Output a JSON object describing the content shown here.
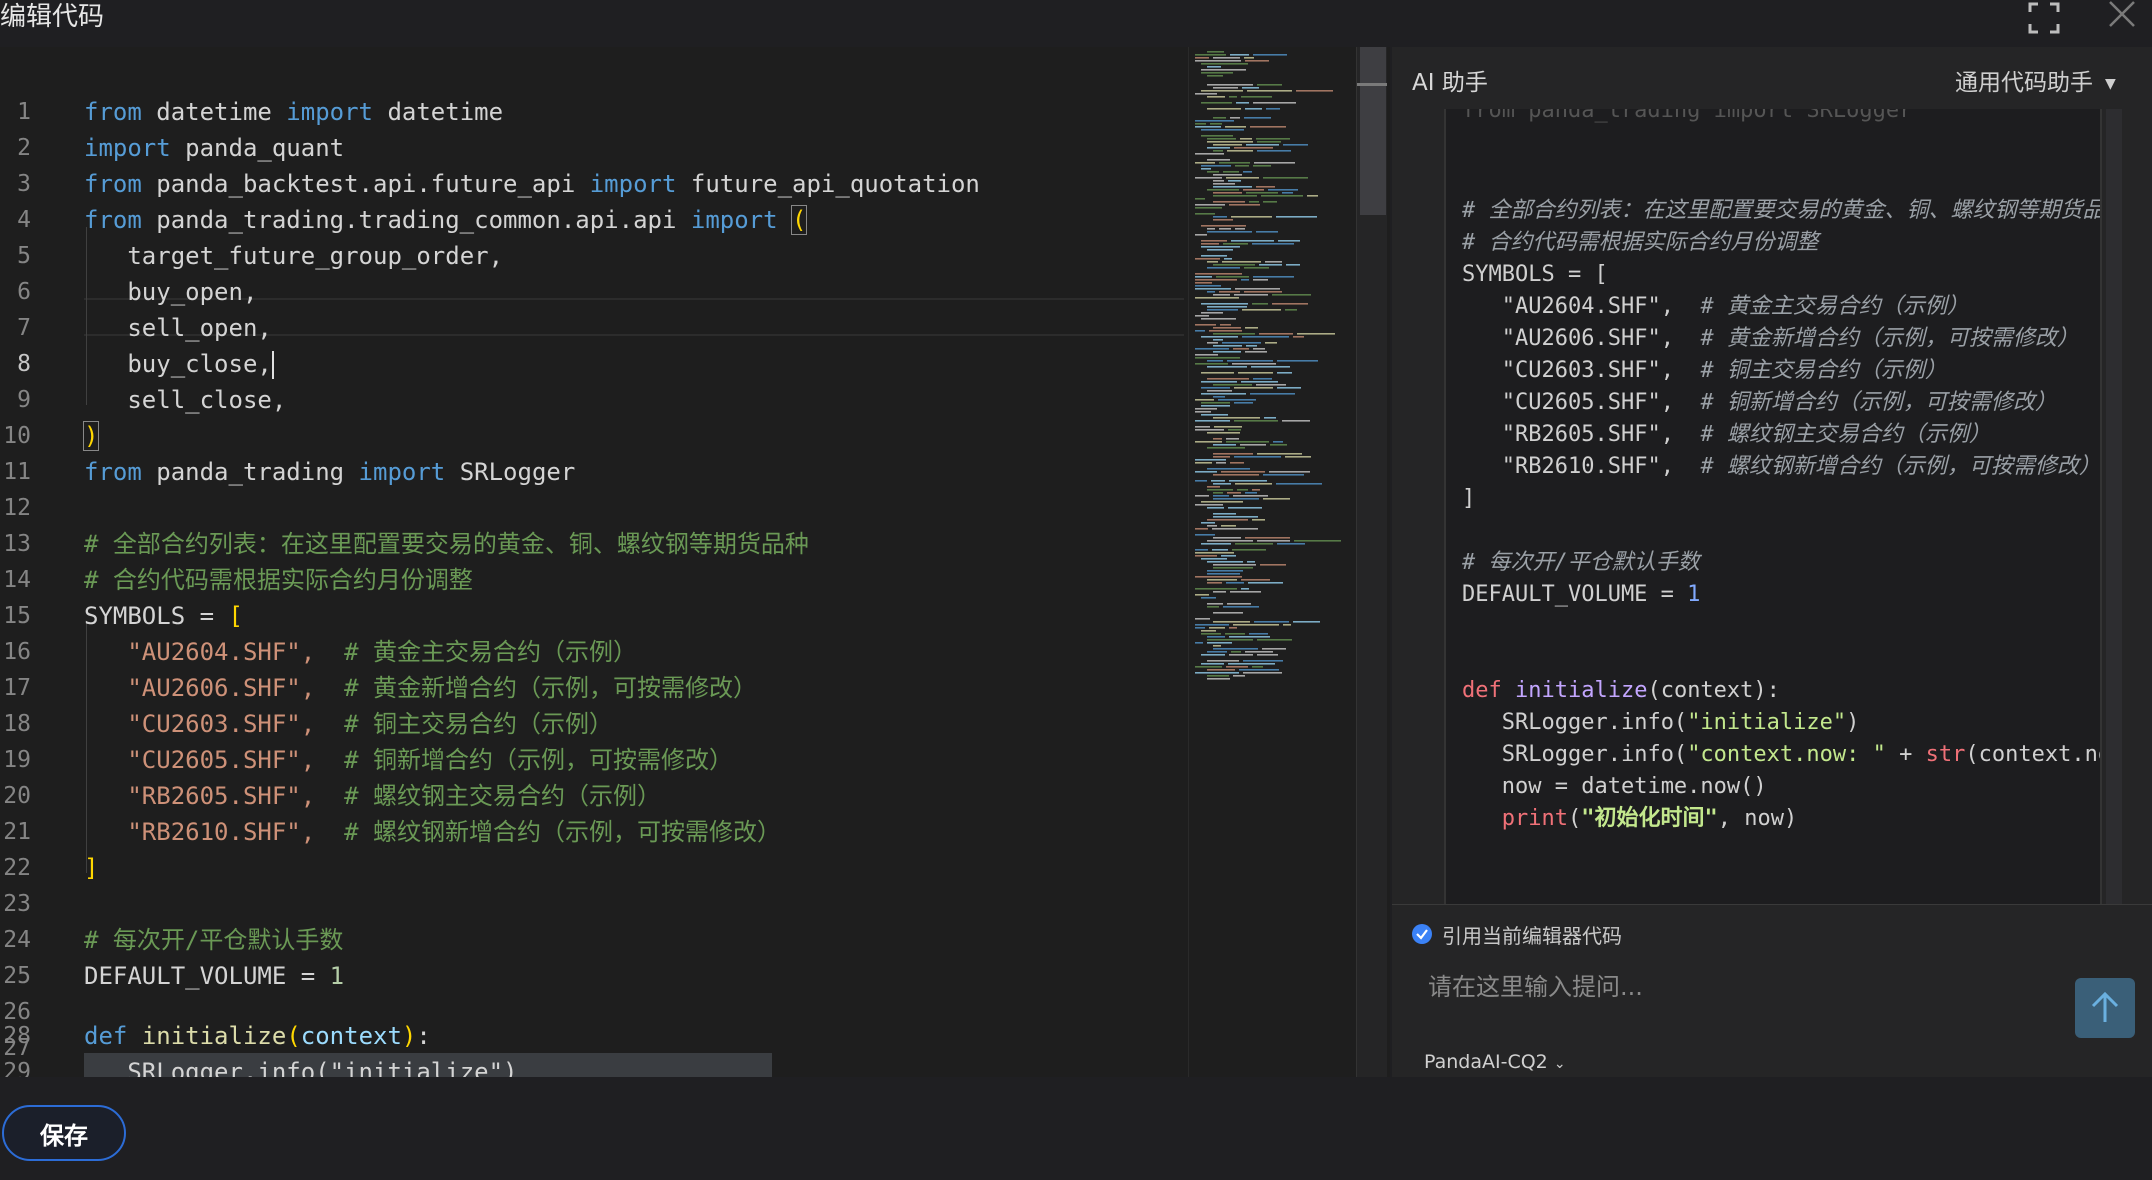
{
  "dialog": {
    "title": "编辑代码"
  },
  "editor": {
    "lines": [
      {
        "n": "1"
      },
      {
        "n": "2"
      },
      {
        "n": "3"
      },
      {
        "n": "4"
      },
      {
        "n": "5"
      },
      {
        "n": "6"
      },
      {
        "n": "7"
      },
      {
        "n": "8"
      },
      {
        "n": "9"
      },
      {
        "n": "10"
      },
      {
        "n": "11"
      },
      {
        "n": "12"
      },
      {
        "n": "13"
      },
      {
        "n": "14"
      },
      {
        "n": "15"
      },
      {
        "n": "16"
      },
      {
        "n": "17"
      },
      {
        "n": "18"
      },
      {
        "n": "19"
      },
      {
        "n": "20"
      },
      {
        "n": "21"
      },
      {
        "n": "22"
      },
      {
        "n": "23"
      },
      {
        "n": "24"
      },
      {
        "n": "25"
      },
      {
        "n": "26"
      },
      {
        "n": "27"
      },
      {
        "n": "28"
      },
      {
        "n": "29"
      }
    ],
    "tokens": {
      "from": "from",
      "import": "import",
      "def": "def",
      "datetime": "datetime",
      "panda_quant": "panda_quant",
      "mod_future_api": "panda_backtest.api.future_api",
      "future_api_quotation": "future_api_quotation",
      "mod_trading_api": "panda_trading.trading_common.api.api",
      "open_paren": "(",
      "close_paren": ")",
      "target_future_group_order": "target_future_group_order,",
      "buy_open": "buy_open,",
      "sell_open": "sell_open,",
      "buy_close": "buy_close,",
      "sell_close": "sell_close,",
      "panda_trading": "panda_trading",
      "SRLogger": "SRLogger",
      "comment1": "# 全部合约列表：在这里配置要交易的黄金、铜、螺纹钢等期货品种",
      "comment2": "# 合约代码需根据实际合约月份调整",
      "symbols_assign": "SYMBOLS = ",
      "open_bracket": "[",
      "close_bracket": "]",
      "sym1": "\"AU2604.SHF\",",
      "sym1c": "# 黄金主交易合约（示例）",
      "sym2": "\"AU2606.SHF\",",
      "sym2c": "# 黄金新增合约（示例，可按需修改）",
      "sym3": "\"CU2603.SHF\",",
      "sym3c": "# 铜主交易合约（示例）",
      "sym4": "\"CU2605.SHF\",",
      "sym4c": "# 铜新增合约（示例，可按需修改）",
      "sym5": "\"RB2605.SHF\",",
      "sym5c": "# 螺纹钢主交易合约（示例）",
      "sym6": "\"RB2610.SHF\",",
      "sym6c": "# 螺纹钢新增合约（示例，可按需修改）",
      "comment3": "# 每次开/平仓默认手数",
      "default_volume": "DEFAULT_VOLUME = ",
      "one": "1",
      "initialize": "initialize",
      "context": "context",
      "colon": ":",
      "line29": "SRLogger.info(\"initialize\")"
    }
  },
  "ai_panel": {
    "title": "AI 助手",
    "assistant_select": "通用代码助手",
    "code": {
      "l0": "from panda_trading import SRLogger",
      "l1": "# 全部合约列表：在这里配置要交易的黄金、铜、螺纹钢等期货品种",
      "l2": "# 合约代码需根据实际合约月份调整",
      "l3": "SYMBOLS = [",
      "s1": "\"AU2604.SHF\",",
      "s1c": "# 黄金主交易合约（示例）",
      "s2": "\"AU2606.SHF\",",
      "s2c": "# 黄金新增合约（示例，可按需修改）",
      "s3": "\"CU2603.SHF\",",
      "s3c": "# 铜主交易合约（示例）",
      "s4": "\"CU2605.SHF\",",
      "s4c": "# 铜新增合约（示例，可按需修改）",
      "s5": "\"RB2605.SHF\",",
      "s5c": "# 螺纹钢主交易合约（示例）",
      "s6": "\"RB2610.SHF\",",
      "s6c": "# 螺纹钢新增合约（示例，可按需修改）",
      "close": "]",
      "c3": "# 每次开/平仓默认手数",
      "dv": "DEFAULT_VOLUME = ",
      "dv1": "1",
      "def": "def",
      "init": "initialize",
      "init_args": "(context):",
      "i1a": "SRLogger.info(",
      "i1b": "\"initialize\"",
      "i1c": ")",
      "i2a": "SRLogger.info(",
      "i2b": "\"context.now: \"",
      "i2c": " + ",
      "i2d": "str",
      "i2e": "(context.now))",
      "i3": "now = datetime.now()",
      "i4a": "print",
      "i4b": "(",
      "i4c": "\"初始化时间\"",
      "i4d": ", now)"
    },
    "quote_label": "引用当前编辑器代码",
    "prompt_placeholder": "请在这里输入提问...",
    "model": "PandaAI-CQ2"
  },
  "footer": {
    "save_label": "保存"
  }
}
